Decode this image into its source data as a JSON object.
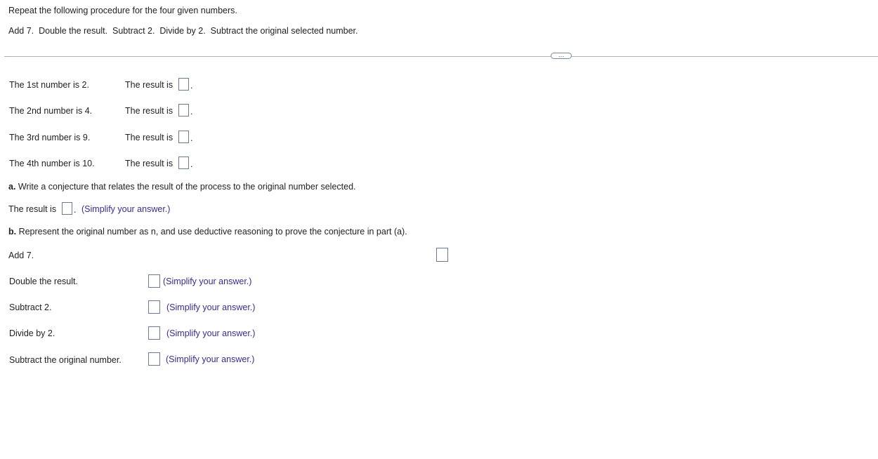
{
  "instructions": {
    "line1": "Repeat the following procedure for the four given numbers.",
    "line2": "Add 7.  Double the result.  Subtract 2.  Divide by 2.  Subtract the original selected number."
  },
  "more_button": {
    "label": "…"
  },
  "numbers": [
    {
      "label": "The 1st number is 2.",
      "result_label": "The result is",
      "period": "."
    },
    {
      "label": "The 2nd number is 4.",
      "result_label": "The result is",
      "period": "."
    },
    {
      "label": "The 3rd number is 9.",
      "result_label": "The result is",
      "period": "."
    },
    {
      "label": "The 4th number is 10.",
      "result_label": "The result is",
      "period": "."
    }
  ],
  "part_a": {
    "marker": "a.",
    "question": " Write a conjecture that relates the result of the process to the original number selected.",
    "result_label": "The result is",
    "period": ".",
    "hint": "(Simplify your answer.)"
  },
  "part_b": {
    "marker": "b.",
    "question": " Represent the original number as n, and use deductive reasoning to prove the conjecture in part (a).",
    "steps": [
      {
        "label": "Add 7."
      },
      {
        "label": "Double the result.",
        "hint": "(Simplify your answer.)"
      },
      {
        "label": "Subtract 2.",
        "hint": "(Simplify your answer.)"
      },
      {
        "label": "Divide by 2.",
        "hint": "(Simplify your answer.)"
      },
      {
        "label": "Subtract the original number.",
        "hint": "(Simplify your answer.)"
      }
    ]
  }
}
